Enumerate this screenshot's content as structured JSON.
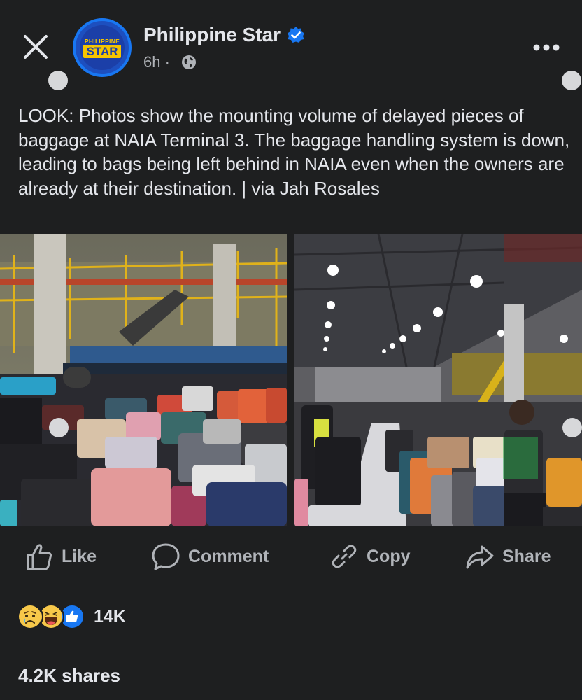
{
  "header": {
    "page_name": "Philippine Star",
    "time": "6h ·",
    "logo": {
      "top": "PHILIPPINE",
      "bottom": "STAR"
    }
  },
  "post": {
    "caption": "LOOK: Photos show the mounting volume of delayed pieces of baggage at NAIA Terminal 3. The baggage handling system is down, leading to bags being left behind in NAIA even when the owners are already at their destination. | via Jah Rosales"
  },
  "actions": {
    "like": "Like",
    "comment": "Comment",
    "copy": "Copy",
    "share": "Share"
  },
  "stats": {
    "reaction_icons": [
      "sad-reaction-icon",
      "haha-reaction-icon",
      "like-reaction-icon"
    ],
    "reactions": "14K",
    "shares": "4.2K shares"
  },
  "colors": {
    "background": "#1e1f20",
    "text": "#e4e6eb",
    "muted": "#b0b3b8",
    "accent": "#1877f2",
    "logo_yellow": "#f5c400"
  }
}
